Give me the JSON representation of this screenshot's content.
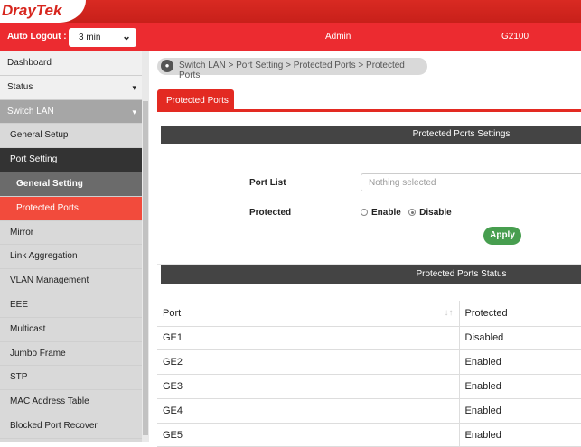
{
  "brand": {
    "logo": "DrayTek"
  },
  "header": {
    "auto_logout_label": "Auto Logout :",
    "auto_logout_value": "3 min",
    "user": "Admin",
    "model": "G2100"
  },
  "sidebar": {
    "items": [
      {
        "label": "Dashboard"
      },
      {
        "label": "Status"
      },
      {
        "label": "Switch LAN"
      },
      {
        "label": "General Setup"
      },
      {
        "label": "Port Setting"
      },
      {
        "label": "General Setting"
      },
      {
        "label": "Protected Ports"
      },
      {
        "label": "Mirror"
      },
      {
        "label": "Link Aggregation"
      },
      {
        "label": "VLAN Management"
      },
      {
        "label": "EEE"
      },
      {
        "label": "Multicast"
      },
      {
        "label": "Jumbo Frame"
      },
      {
        "label": "STP"
      },
      {
        "label": "MAC Address Table"
      },
      {
        "label": "Blocked Port Recover"
      }
    ]
  },
  "breadcrumb": "Switch LAN > Port Setting > Protected Ports  > Protected Ports",
  "tab": "Protected Ports",
  "settings": {
    "title": "Protected Ports Settings",
    "port_list_label": "Port List",
    "port_list_placeholder": "Nothing selected",
    "protected_label": "Protected",
    "enable": "Enable",
    "disable": "Disable",
    "selected": "Disable",
    "apply": "Apply"
  },
  "status": {
    "title": "Protected Ports Status",
    "columns": [
      "Port",
      "Protected"
    ],
    "rows": [
      [
        "GE1",
        "Disabled"
      ],
      [
        "GE2",
        "Enabled"
      ],
      [
        "GE3",
        "Enabled"
      ],
      [
        "GE4",
        "Enabled"
      ],
      [
        "GE5",
        "Enabled"
      ]
    ]
  }
}
